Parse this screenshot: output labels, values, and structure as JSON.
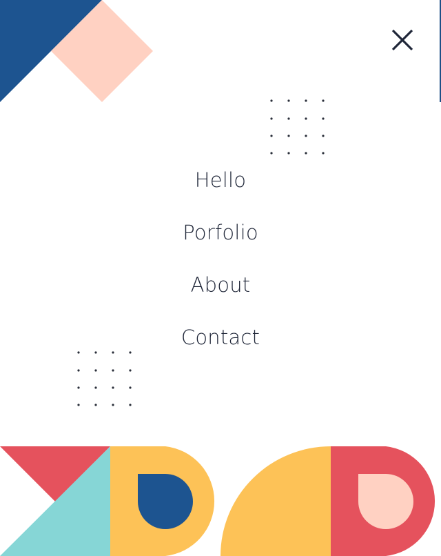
{
  "close_button": {
    "icon": "close-icon",
    "aria_label": "Close menu"
  },
  "nav": {
    "items": [
      {
        "label": "Hello"
      },
      {
        "label": "Porfolio"
      },
      {
        "label": "About"
      },
      {
        "label": "Contact"
      }
    ]
  },
  "colors": {
    "navy": "#1d5490",
    "peach": "#ffd1c2",
    "red": "#e5525d",
    "teal": "#86d6d6",
    "yellow": "#fdc257",
    "text": "#1f2638",
    "dots": "#2a2f3a"
  }
}
